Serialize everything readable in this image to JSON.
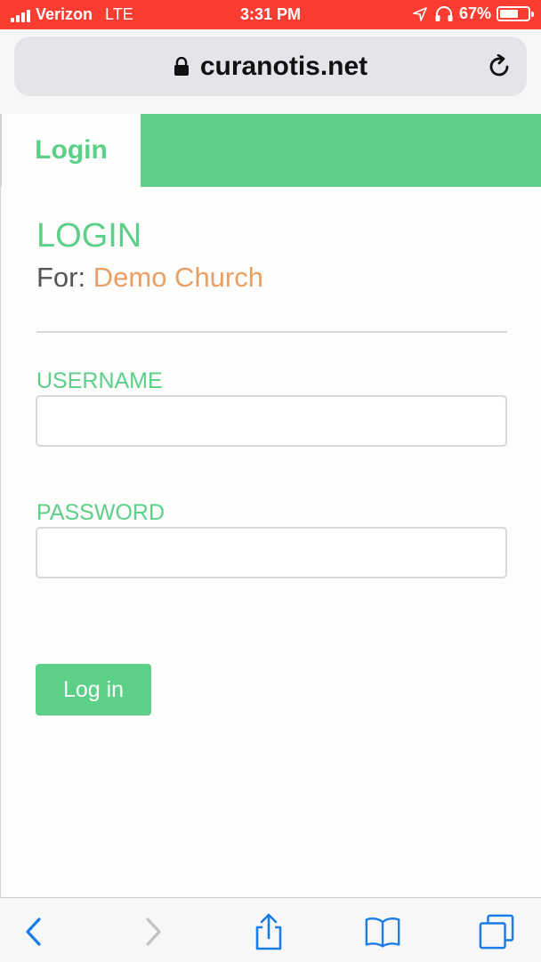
{
  "status_bar": {
    "carrier": "Verizon",
    "network": "LTE",
    "time": "3:31 PM",
    "battery": "67%",
    "battery_level": 0.67
  },
  "browser": {
    "url": "curanotis.net",
    "icons": [
      "lock-icon",
      "reload-icon",
      "back-icon",
      "forward-icon",
      "share-icon",
      "bookmarks-icon",
      "tabs-icon"
    ]
  },
  "page": {
    "tab_label": "Login",
    "title": "LOGIN",
    "for_prefix": "For:",
    "church_name": "Demo Church",
    "username_label": "USERNAME",
    "username_value": "",
    "password_label": "PASSWORD",
    "password_value": "",
    "login_button": "Log in"
  },
  "colors": {
    "status_bar": "#fb3d31",
    "accent_green": "#5ccf89",
    "church_orange": "#e8a066",
    "ios_blue": "#1a7ce6"
  }
}
